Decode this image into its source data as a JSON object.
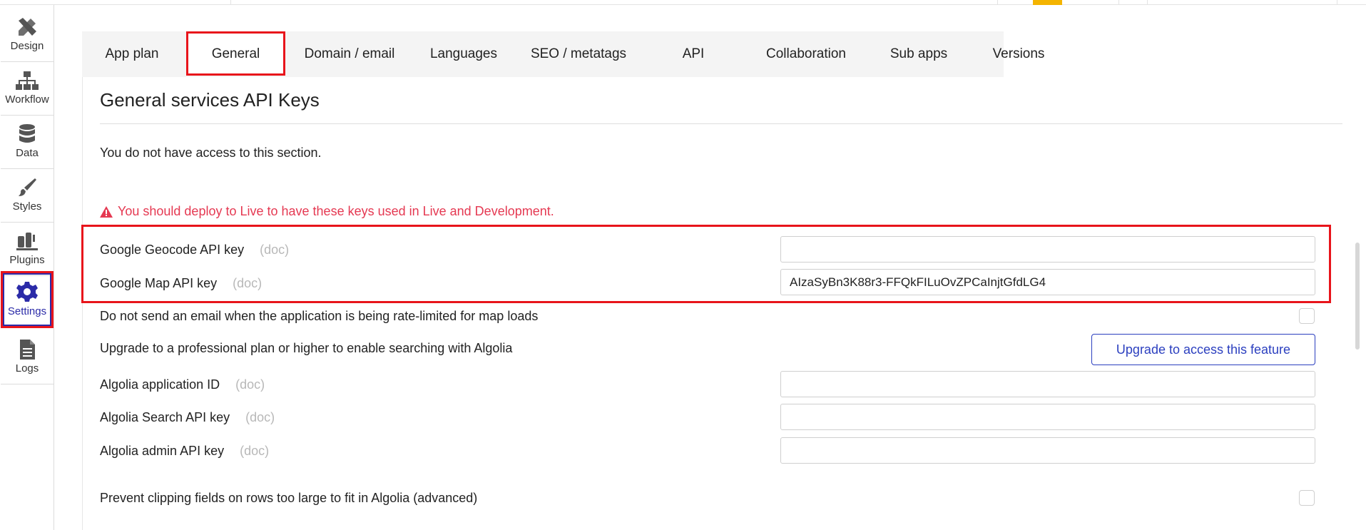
{
  "sidebar": {
    "items": [
      {
        "label": "Design",
        "icon": "design-icon"
      },
      {
        "label": "Workflow",
        "icon": "workflow-icon"
      },
      {
        "label": "Data",
        "icon": "database-icon"
      },
      {
        "label": "Styles",
        "icon": "brush-icon"
      },
      {
        "label": "Plugins",
        "icon": "plug-icon"
      },
      {
        "label": "Settings",
        "icon": "gear-icon",
        "active": true
      },
      {
        "label": "Logs",
        "icon": "document-icon"
      }
    ]
  },
  "tabs": [
    {
      "label": "App plan"
    },
    {
      "label": "General",
      "active": true
    },
    {
      "label": "Domain / email"
    },
    {
      "label": "Languages"
    },
    {
      "label": "SEO / metatags"
    },
    {
      "label": "API"
    },
    {
      "label": "Collaboration"
    },
    {
      "label": "Sub apps"
    },
    {
      "label": "Versions"
    }
  ],
  "section": {
    "title": "General services API Keys",
    "no_access": "You do not have access to this section.",
    "warning": "You should deploy to Live to have these keys used in Live and Development."
  },
  "fields": {
    "geocode_label": "Google Geocode API key",
    "geocode_value": "",
    "map_label": "Google Map API key",
    "map_value": "AIzaSyBn3K88r3-FFQkFILuOvZPCaInjtGfdLG4",
    "rate_limit_label": "Do not send an email when the application is being rate-limited for map loads",
    "algolia_upgrade_label": "Upgrade to a professional plan or higher to enable searching with Algolia",
    "upgrade_button": "Upgrade to access this feature",
    "algolia_app_id_label": "Algolia application ID",
    "algolia_search_label": "Algolia Search API key",
    "algolia_admin_label": "Algolia admin API key",
    "prevent_clipping_label": "Prevent clipping fields on rows too large to fit in Algolia (advanced)",
    "doc": "(doc)"
  },
  "colors": {
    "accent_red": "#e8141b",
    "warning_pink": "#e53952",
    "link_blue": "#2b3fbf",
    "settings_blue": "#2b2ba8"
  }
}
